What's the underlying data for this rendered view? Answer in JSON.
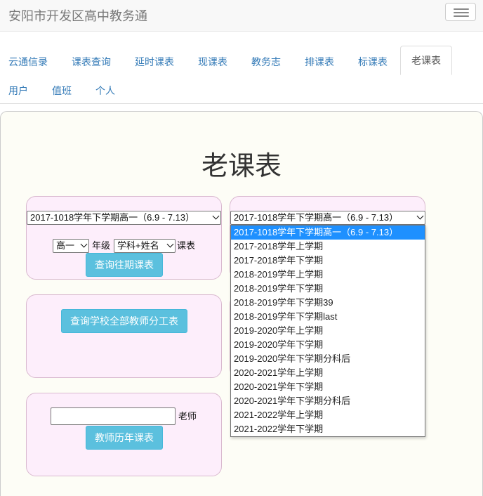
{
  "navbar": {
    "brand": "安阳市开发区高中教务通",
    "toggle_icon": "hamburger-icon"
  },
  "tabs": [
    {
      "label": "云通信录"
    },
    {
      "label": "课表查询"
    },
    {
      "label": "延时课表"
    },
    {
      "label": "现课表"
    },
    {
      "label": "教务志"
    },
    {
      "label": "排课表"
    },
    {
      "label": "标课表"
    },
    {
      "label": "老课表",
      "active": true
    },
    {
      "label": "用户"
    },
    {
      "label": "值班"
    },
    {
      "label": "个人"
    }
  ],
  "main": {
    "title": "老课表"
  },
  "query_past": {
    "term_select": "2017-1018学年下学期高一（6.9 - 7.13）",
    "grade_select": "高一",
    "grade_label": "年级",
    "mode_select": "学科+姓名",
    "course_label": "课表",
    "button": "查询往期课表"
  },
  "term_dropdown": {
    "selected": "2017-1018学年下学期高一（6.9 - 7.13）",
    "options": [
      "2017-1018学年下学期高一（6.9 - 7.13）",
      "2017-2018学年上学期",
      "2017-2018学年下学期",
      "2018-2019学年上学期",
      "2018-2019学年下学期",
      "2018-2019学年下学期39",
      "2018-2019学年下学期last",
      "2019-2020学年上学期",
      "2019-2020学年下学期",
      "2019-2020学年下学期分科后",
      "2020-2021学年上学期",
      "2020-2021学年下学期",
      "2020-2021学年下学期分科后",
      "2021-2022学年上学期",
      "2021-2022学年下学期"
    ]
  },
  "all_teachers": {
    "button": "查询学校全部教师分工表"
  },
  "teacher_history": {
    "input_value": "",
    "teacher_label": "老师",
    "button": "教师历年课表"
  }
}
